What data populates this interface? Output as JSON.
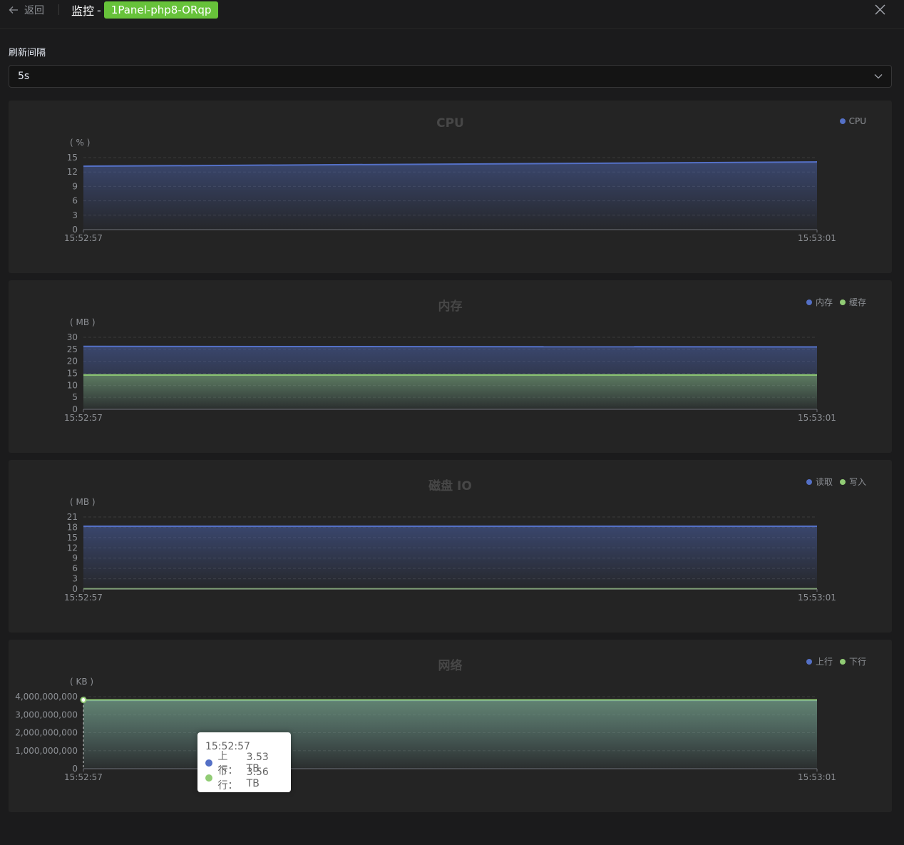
{
  "header": {
    "back_label": "返回",
    "title": "监控",
    "separator": "-",
    "container_tag": "1Panel-php8-ORqp"
  },
  "refresh": {
    "label": "刷新间隔",
    "value": "5s"
  },
  "colors": {
    "series_blue": "#5470c6",
    "series_green": "#91cc75",
    "tag_green": "#67c23a"
  },
  "charts": [
    {
      "title": "CPU",
      "unit": "( % )",
      "legend": [
        {
          "name": "CPU",
          "color": "#5470c6"
        }
      ]
    },
    {
      "title": "内存",
      "unit": "( MB )",
      "legend": [
        {
          "name": "内存",
          "color": "#5470c6"
        },
        {
          "name": "缓存",
          "color": "#91cc75"
        }
      ]
    },
    {
      "title": "磁盘 IO",
      "unit": "( MB )",
      "legend": [
        {
          "name": "读取",
          "color": "#5470c6"
        },
        {
          "name": "写入",
          "color": "#91cc75"
        }
      ]
    },
    {
      "title": "网络",
      "unit": "( KB )",
      "legend": [
        {
          "name": "上行",
          "color": "#5470c6"
        },
        {
          "name": "下行",
          "color": "#91cc75"
        }
      ]
    }
  ],
  "chart_data": [
    {
      "type": "area",
      "title": "CPU",
      "ylabel": "( % )",
      "x": [
        "15:52:57",
        "15:53:01"
      ],
      "ylim": [
        0,
        15
      ],
      "yticks": [
        "0",
        "3",
        "6",
        "9",
        "12",
        "15"
      ],
      "series": [
        {
          "name": "CPU",
          "values": [
            13.2,
            14.1
          ]
        }
      ],
      "grid": true,
      "legend": "top-right"
    },
    {
      "type": "area",
      "title": "内存",
      "ylabel": "( MB )",
      "x": [
        "15:52:57",
        "15:53:01"
      ],
      "ylim": [
        0,
        30
      ],
      "yticks": [
        "0",
        "5",
        "10",
        "15",
        "20",
        "25",
        "30"
      ],
      "series": [
        {
          "name": "内存",
          "values": [
            26.2,
            26.0
          ]
        },
        {
          "name": "缓存",
          "values": [
            14.3,
            14.3
          ]
        }
      ],
      "grid": true,
      "legend": "top-right"
    },
    {
      "type": "area",
      "title": "磁盘 IO",
      "ylabel": "( MB )",
      "x": [
        "15:52:57",
        "15:53:01"
      ],
      "ylim": [
        0,
        21
      ],
      "yticks": [
        "0",
        "3",
        "6",
        "9",
        "12",
        "15",
        "18",
        "21"
      ],
      "series": [
        {
          "name": "读取",
          "values": [
            18.3,
            18.3
          ]
        },
        {
          "name": "写入",
          "values": [
            0.05,
            0.05
          ]
        }
      ],
      "grid": true,
      "legend": "top-right"
    },
    {
      "type": "area",
      "title": "网络",
      "ylabel": "( KB )",
      "x": [
        "15:52:57",
        "15:53:01"
      ],
      "ylim": [
        0,
        4000000000
      ],
      "yticks": [
        "0",
        "1,000,000,000",
        "2,000,000,000",
        "3,000,000,000",
        "4,000,000,000"
      ],
      "series": [
        {
          "name": "上行",
          "values": [
            3790000000,
            3790000000
          ]
        },
        {
          "name": "下行",
          "values": [
            3820000000,
            3820000000
          ]
        }
      ],
      "grid": true,
      "legend": "top-right"
    }
  ],
  "tooltip": {
    "time": "15:52:57",
    "rows": [
      {
        "label": "上行：",
        "value": "3.53 TB",
        "color": "#5470c6"
      },
      {
        "label": "下行：",
        "value": "3.56 TB",
        "color": "#91cc75"
      }
    ]
  }
}
